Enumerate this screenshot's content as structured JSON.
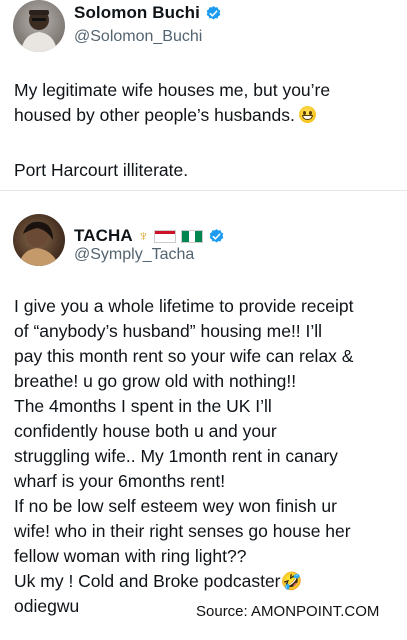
{
  "post1": {
    "display_name": "Solomon Buchi",
    "handle": "@Solomon_Buchi",
    "text_line1": "My legitimate wife houses me, but you’re",
    "text_line2": "housed by other people’s husbands.",
    "text_line3": "Port Harcourt illiterate."
  },
  "post2": {
    "display_name": "TACHA",
    "handle": "@Symply_Tacha",
    "lines": [
      "I give you a whole lifetime to provide receipt",
      "of “anybody’s husband” housing me!! I’ll",
      "pay this month rent so your wife can relax &",
      "breathe! u go grow old with nothing!!",
      " The 4months I spent in the UK I’ll",
      "confidently house both u and your",
      "struggling wife.. My 1month rent in canary",
      "wharf is your 6months rent!",
      " If no be low self esteem wey won finish ur",
      "wife! who in their right senses go house her",
      "fellow woman with ring light??",
      "Uk my          ! Cold and Broke podcaster🤣",
      "odiegwu"
    ]
  },
  "watermark": "Source: AMONPOINT.COM",
  "colors": {
    "verified_blue": "#1d9bf0",
    "text": "#0f1419",
    "secondary_text": "#536471"
  },
  "icons": {
    "verified": "verified-badge-icon",
    "flag_ghana": "ghana-flag-icon",
    "flag_nigeria": "nigeria-flag-icon",
    "emoji_grin": "grinning-emoji-icon",
    "emoji_laugh": "rolling-laughing-emoji-icon",
    "trident": "trident-icon"
  }
}
